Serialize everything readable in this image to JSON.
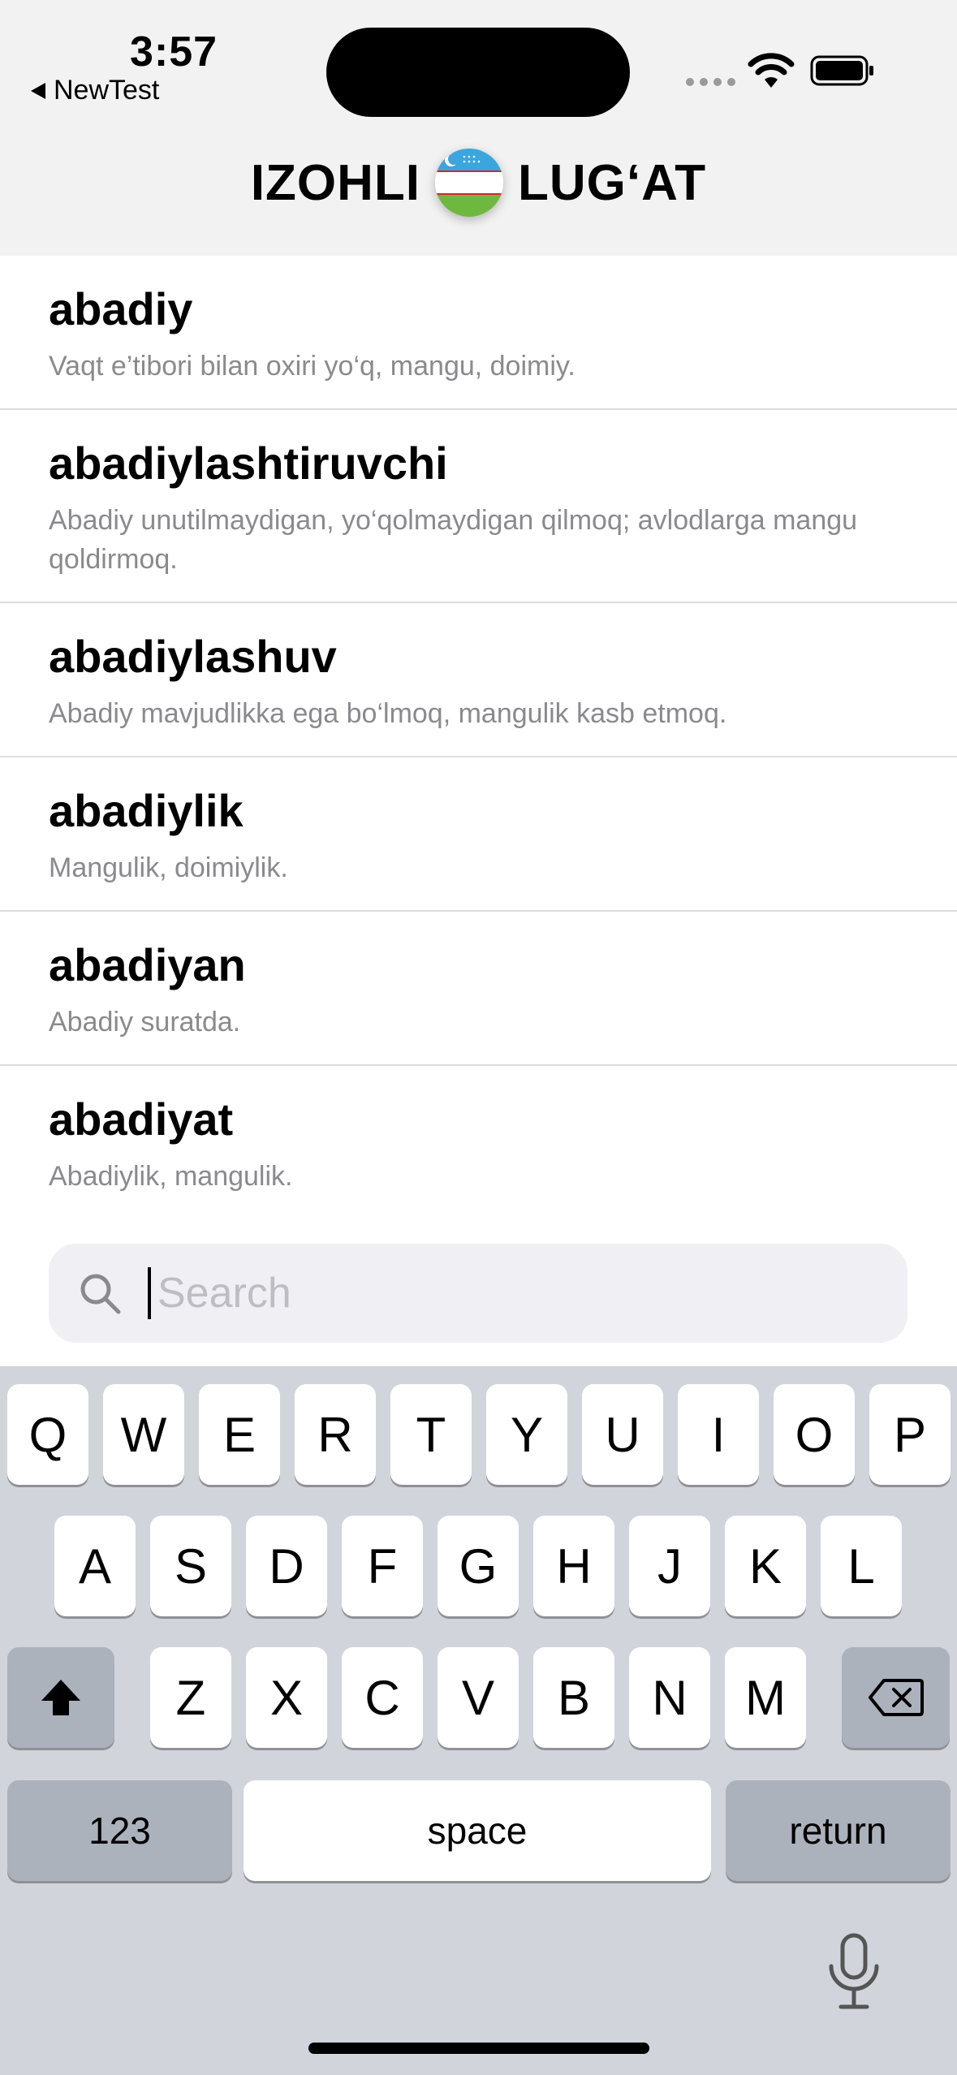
{
  "status_bar": {
    "time": "3:57",
    "back_label": "NewTest"
  },
  "header": {
    "title_left": "IZOHLI",
    "title_right": "LUG‘AT"
  },
  "entries": [
    {
      "word": "abadiy",
      "definition": "Vaqt e’tibori bilan oxiri yo‘q, mangu, doimiy."
    },
    {
      "word": "abadiylashtiruvchi",
      "definition": "Abadiy unutilmaydigan, yo‘qolmaydigan qilmoq; avlodlarga mangu qoldirmoq."
    },
    {
      "word": "abadiylashuv",
      "definition": "Abadiy mavjudlikka ega bo‘lmoq, mangulik kasb etmoq."
    },
    {
      "word": "abadiylik",
      "definition": "Mangulik, doimiylik."
    },
    {
      "word": "abadiyan",
      "definition": "Abadiy suratda."
    },
    {
      "word": "abadiyat",
      "definition": "Abadiylik, mangulik."
    }
  ],
  "search": {
    "placeholder": "Search",
    "value": ""
  },
  "keyboard": {
    "row1": [
      "Q",
      "W",
      "E",
      "R",
      "T",
      "Y",
      "U",
      "I",
      "O",
      "P"
    ],
    "row2": [
      "A",
      "S",
      "D",
      "F",
      "G",
      "H",
      "J",
      "K",
      "L"
    ],
    "row3": [
      "Z",
      "X",
      "C",
      "V",
      "B",
      "N",
      "M"
    ],
    "numbers_label": "123",
    "space_label": "space",
    "return_label": "return"
  }
}
